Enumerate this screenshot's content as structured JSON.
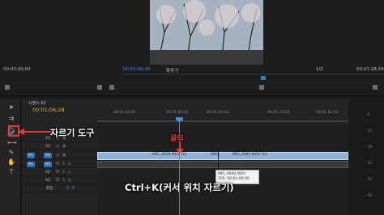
{
  "monitor": {
    "left_timecode": "00;00;00;00",
    "current_timecode": "00;01;06;28",
    "fit_label": "맞추기",
    "resolution_label": "1/2",
    "right_timecode": "00;01;28;29"
  },
  "timeline": {
    "sequence_tab": "시퀀스 01",
    "current_timecode": "00;01;06;28",
    "ruler_labels": [
      "00;01;04;02",
      "00;01;06;02",
      "00;01;08;02",
      "00;01;10;02",
      "00;01;12;02"
    ],
    "tracks": [
      {
        "target": "",
        "name": "V3",
        "target_on": false
      },
      {
        "target": "",
        "name": "V2",
        "target_on": false
      },
      {
        "target": "V1",
        "name": "V1",
        "target_on": true
      },
      {
        "target": "A1",
        "name": "A1",
        "target_on": true
      },
      {
        "target": "",
        "name": "A2",
        "target_on": false
      },
      {
        "target": "",
        "name": "A3",
        "target_on": false
      },
      {
        "target": "",
        "name": "혼합",
        "target_on": false
      }
    ],
    "mix_value": "0.0",
    "clips": [
      {
        "label": "IMG_0938.MOV [V]"
      },
      {
        "label": "IMG_"
      },
      {
        "label": "IMG_0940.MOV [V]"
      }
    ],
    "tooltip": {
      "name": "IMG_0940.MOV",
      "duration": "지속: 00;01;00;00"
    }
  },
  "annotations": {
    "razor_tool": "자르기 도구",
    "click": "클릭",
    "shortcut": "Ctrl+K(커서 위치 자르기)"
  },
  "colors": {
    "accent": "#3b8de6",
    "annotation_red": "#e53935",
    "timecode_yellow": "#e0b23e",
    "clip_video": "#8fb2d8"
  }
}
